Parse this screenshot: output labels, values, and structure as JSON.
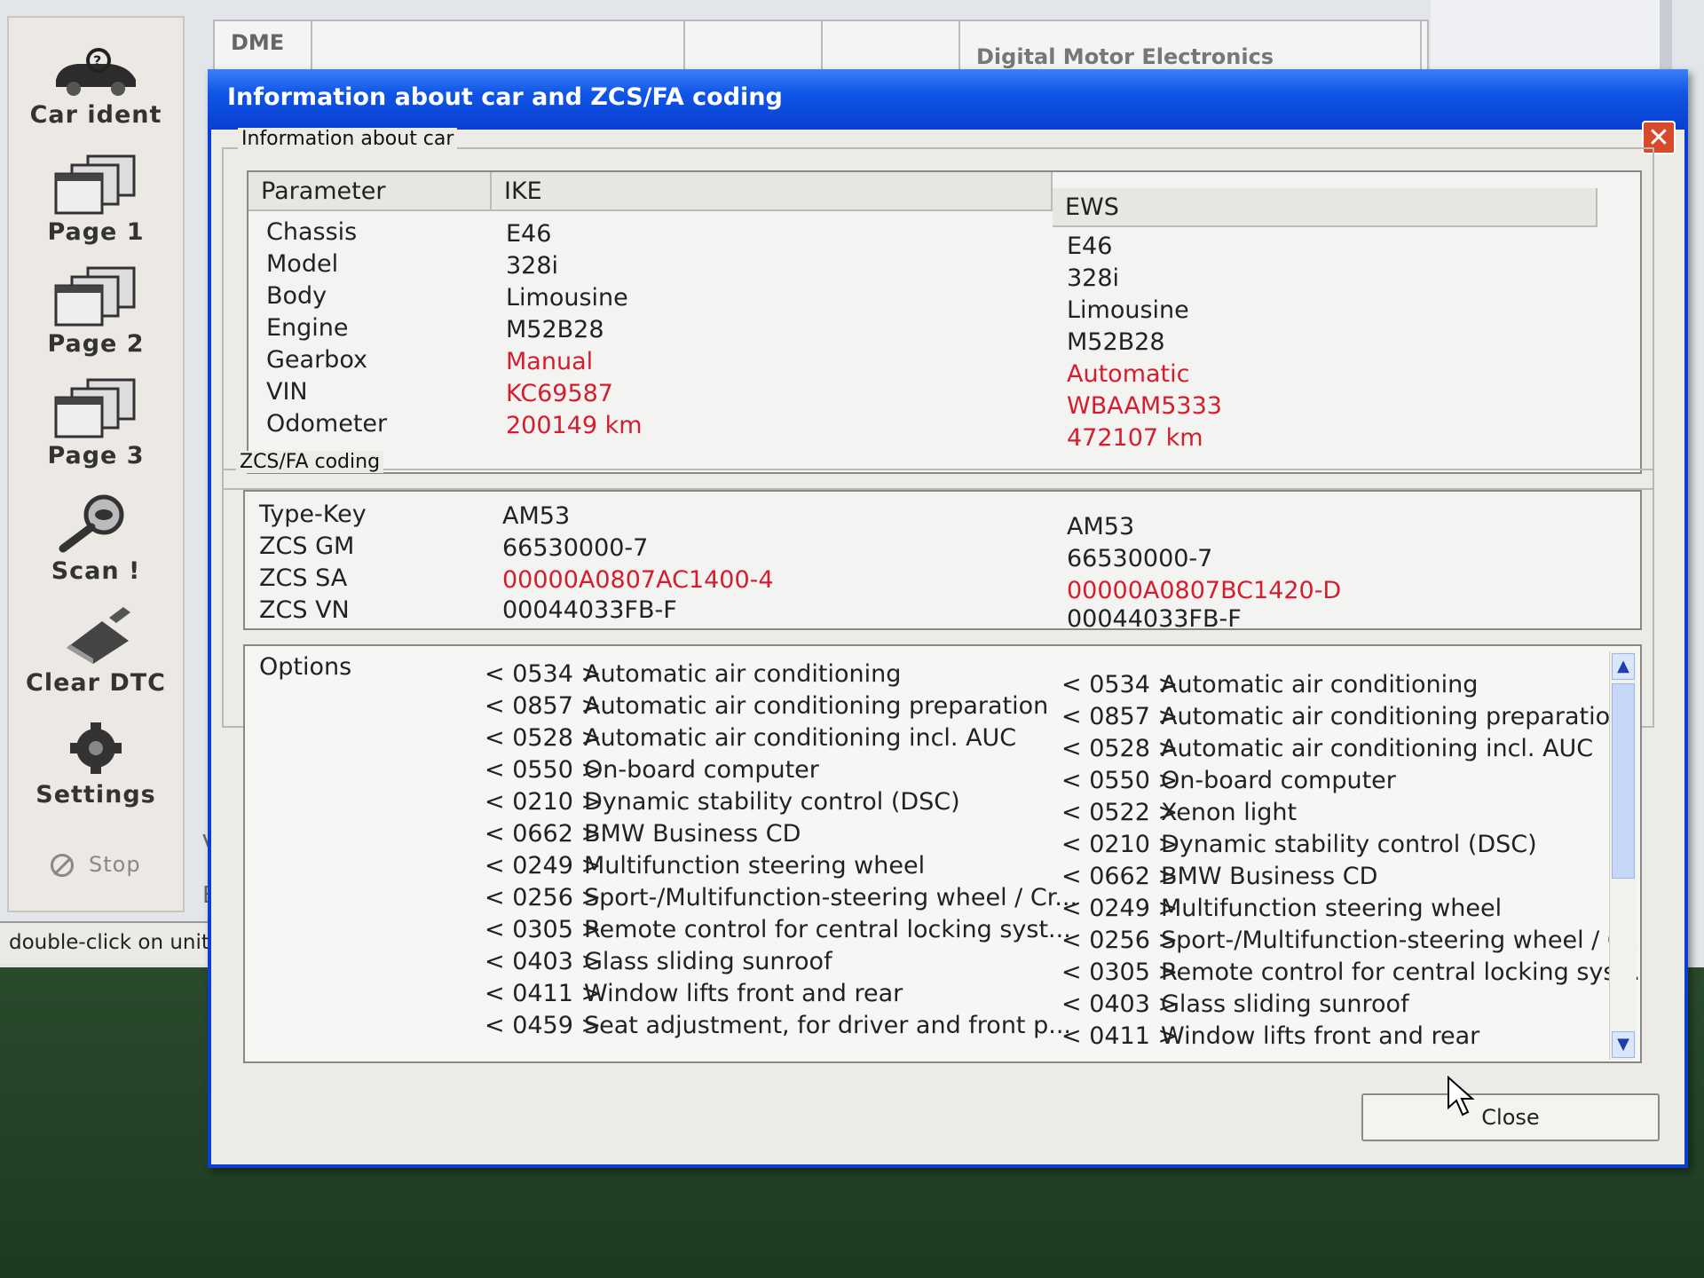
{
  "sidebar": {
    "items": [
      {
        "label": "Car ident",
        "icon": "car-ident-icon"
      },
      {
        "label": "Page 1",
        "icon": "page-icon"
      },
      {
        "label": "Page 2",
        "icon": "page-icon"
      },
      {
        "label": "Page 3",
        "icon": "page-icon"
      },
      {
        "label": "Scan !",
        "icon": "magnifier-icon"
      },
      {
        "label": "Clear DTC",
        "icon": "eraser-icon"
      },
      {
        "label": "Settings",
        "icon": "gear-icon"
      }
    ],
    "stop_label": "Stop"
  },
  "status_bar": {
    "text": "double-click on unit's r"
  },
  "bg_table": {
    "header_unit": "DME",
    "header_desc": "Digital Motor Electronics",
    "row_letters": [
      "V",
      "E"
    ]
  },
  "dialog": {
    "title": "Information about car and ZCS/FA coding",
    "car_group_title": "Information about car",
    "headers": {
      "parameter": "Parameter",
      "ike": "IKE",
      "ews": "EWS"
    },
    "rows": [
      {
        "param": "Chassis",
        "ike": "E46",
        "ews": "E46"
      },
      {
        "param": "Model",
        "ike": "328i",
        "ews": "328i"
      },
      {
        "param": "Body",
        "ike": "Limousine",
        "ews": "Limousine"
      },
      {
        "param": "Engine",
        "ike": "M52B28",
        "ews": "M52B28"
      },
      {
        "param": "Gearbox",
        "ike": "Manual",
        "ews": "Automatic"
      },
      {
        "param": "VIN",
        "ike": "KC69587",
        "ews": "WBAAM5333"
      },
      {
        "param": "Odometer",
        "ike": "200149 km",
        "ews": "472107 km"
      }
    ],
    "coding_group_title": "ZCS/FA coding",
    "coding_rows": [
      {
        "param": "Type-Key",
        "ike": "AM53",
        "ews": "AM53"
      },
      {
        "param": "ZCS GM",
        "ike": "66530000-7",
        "ews": "66530000-7"
      },
      {
        "param": "ZCS SA",
        "ike": "00000A0807AC1400-4",
        "ews": "00000A0807BC1420-D"
      },
      {
        "param": "ZCS VN",
        "ike": "00044033FB-F",
        "ews": "00044033FB-F"
      }
    ],
    "options_label": "Options",
    "ike_options": [
      {
        "code": "< 0534 >",
        "name": "Automatic air conditioning"
      },
      {
        "code": "< 0857 >",
        "name": "Automatic air conditioning preparation"
      },
      {
        "code": "< 0528 >",
        "name": "Automatic air conditioning incl. AUC"
      },
      {
        "code": "< 0550 >",
        "name": "On-board computer"
      },
      {
        "code": "< 0210 >",
        "name": "Dynamic stability control (DSC)"
      },
      {
        "code": "< 0662 >",
        "name": "BMW Business CD"
      },
      {
        "code": "< 0249 >",
        "name": "Multifunction steering wheel"
      },
      {
        "code": "< 0256 >",
        "name": "Sport-/Multifunction-steering wheel / Cr..."
      },
      {
        "code": "< 0305 >",
        "name": "Remote control for central locking syst..."
      },
      {
        "code": "< 0403 >",
        "name": "Glass sliding sunroof"
      },
      {
        "code": "< 0411 >",
        "name": "Window lifts front and rear"
      },
      {
        "code": "< 0459 >",
        "name": "Seat adjustment, for driver and front p..."
      }
    ],
    "ews_options": [
      {
        "code": "< 0534 >",
        "name": "Automatic air conditioning"
      },
      {
        "code": "< 0857 >",
        "name": "Automatic air conditioning preparation"
      },
      {
        "code": "< 0528 >",
        "name": "Automatic air conditioning incl. AUC"
      },
      {
        "code": "< 0550 >",
        "name": "On-board computer"
      },
      {
        "code": "< 0522 >",
        "name": "Xenon light"
      },
      {
        "code": "< 0210 >",
        "name": "Dynamic stability control (DSC)"
      },
      {
        "code": "< 0662 >",
        "name": "BMW Business CD"
      },
      {
        "code": "< 0249 >",
        "name": "Multifunction steering wheel"
      },
      {
        "code": "< 0256 >",
        "name": "Sport-/Multifunction-steering wheel / Cr..."
      },
      {
        "code": "< 0305 >",
        "name": "Remote control for central locking syst..."
      },
      {
        "code": "< 0403 >",
        "name": "Glass sliding sunroof"
      },
      {
        "code": "< 0411 >",
        "name": "Window lifts front and rear"
      }
    ],
    "close_label": "Close",
    "colors": {
      "titlebar": "#0a3fd0",
      "mismatch": "#d41e2e"
    }
  }
}
